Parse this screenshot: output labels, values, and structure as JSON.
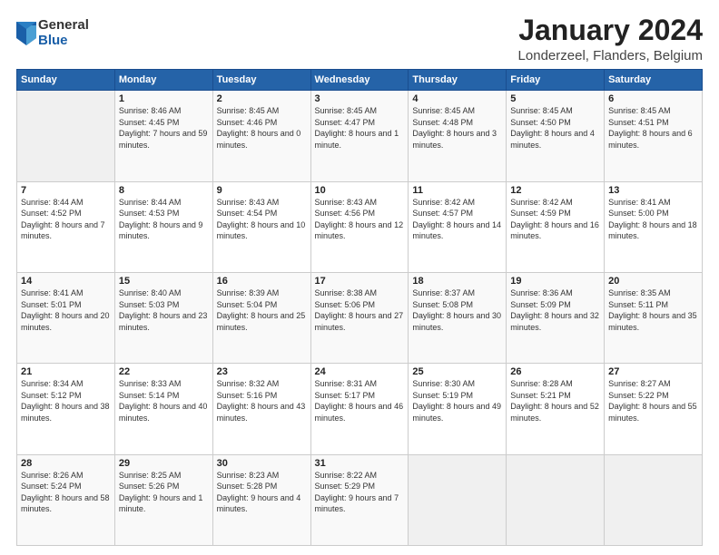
{
  "logo": {
    "general": "General",
    "blue": "Blue"
  },
  "title": "January 2024",
  "subtitle": "Londerzeel, Flanders, Belgium",
  "days_of_week": [
    "Sunday",
    "Monday",
    "Tuesday",
    "Wednesday",
    "Thursday",
    "Friday",
    "Saturday"
  ],
  "weeks": [
    [
      {
        "day": "",
        "sunrise": "",
        "sunset": "",
        "daylight": ""
      },
      {
        "day": "1",
        "sunrise": "Sunrise: 8:46 AM",
        "sunset": "Sunset: 4:45 PM",
        "daylight": "Daylight: 7 hours and 59 minutes."
      },
      {
        "day": "2",
        "sunrise": "Sunrise: 8:45 AM",
        "sunset": "Sunset: 4:46 PM",
        "daylight": "Daylight: 8 hours and 0 minutes."
      },
      {
        "day": "3",
        "sunrise": "Sunrise: 8:45 AM",
        "sunset": "Sunset: 4:47 PM",
        "daylight": "Daylight: 8 hours and 1 minute."
      },
      {
        "day": "4",
        "sunrise": "Sunrise: 8:45 AM",
        "sunset": "Sunset: 4:48 PM",
        "daylight": "Daylight: 8 hours and 3 minutes."
      },
      {
        "day": "5",
        "sunrise": "Sunrise: 8:45 AM",
        "sunset": "Sunset: 4:50 PM",
        "daylight": "Daylight: 8 hours and 4 minutes."
      },
      {
        "day": "6",
        "sunrise": "Sunrise: 8:45 AM",
        "sunset": "Sunset: 4:51 PM",
        "daylight": "Daylight: 8 hours and 6 minutes."
      }
    ],
    [
      {
        "day": "7",
        "sunrise": "Sunrise: 8:44 AM",
        "sunset": "Sunset: 4:52 PM",
        "daylight": "Daylight: 8 hours and 7 minutes."
      },
      {
        "day": "8",
        "sunrise": "Sunrise: 8:44 AM",
        "sunset": "Sunset: 4:53 PM",
        "daylight": "Daylight: 8 hours and 9 minutes."
      },
      {
        "day": "9",
        "sunrise": "Sunrise: 8:43 AM",
        "sunset": "Sunset: 4:54 PM",
        "daylight": "Daylight: 8 hours and 10 minutes."
      },
      {
        "day": "10",
        "sunrise": "Sunrise: 8:43 AM",
        "sunset": "Sunset: 4:56 PM",
        "daylight": "Daylight: 8 hours and 12 minutes."
      },
      {
        "day": "11",
        "sunrise": "Sunrise: 8:42 AM",
        "sunset": "Sunset: 4:57 PM",
        "daylight": "Daylight: 8 hours and 14 minutes."
      },
      {
        "day": "12",
        "sunrise": "Sunrise: 8:42 AM",
        "sunset": "Sunset: 4:59 PM",
        "daylight": "Daylight: 8 hours and 16 minutes."
      },
      {
        "day": "13",
        "sunrise": "Sunrise: 8:41 AM",
        "sunset": "Sunset: 5:00 PM",
        "daylight": "Daylight: 8 hours and 18 minutes."
      }
    ],
    [
      {
        "day": "14",
        "sunrise": "Sunrise: 8:41 AM",
        "sunset": "Sunset: 5:01 PM",
        "daylight": "Daylight: 8 hours and 20 minutes."
      },
      {
        "day": "15",
        "sunrise": "Sunrise: 8:40 AM",
        "sunset": "Sunset: 5:03 PM",
        "daylight": "Daylight: 8 hours and 23 minutes."
      },
      {
        "day": "16",
        "sunrise": "Sunrise: 8:39 AM",
        "sunset": "Sunset: 5:04 PM",
        "daylight": "Daylight: 8 hours and 25 minutes."
      },
      {
        "day": "17",
        "sunrise": "Sunrise: 8:38 AM",
        "sunset": "Sunset: 5:06 PM",
        "daylight": "Daylight: 8 hours and 27 minutes."
      },
      {
        "day": "18",
        "sunrise": "Sunrise: 8:37 AM",
        "sunset": "Sunset: 5:08 PM",
        "daylight": "Daylight: 8 hours and 30 minutes."
      },
      {
        "day": "19",
        "sunrise": "Sunrise: 8:36 AM",
        "sunset": "Sunset: 5:09 PM",
        "daylight": "Daylight: 8 hours and 32 minutes."
      },
      {
        "day": "20",
        "sunrise": "Sunrise: 8:35 AM",
        "sunset": "Sunset: 5:11 PM",
        "daylight": "Daylight: 8 hours and 35 minutes."
      }
    ],
    [
      {
        "day": "21",
        "sunrise": "Sunrise: 8:34 AM",
        "sunset": "Sunset: 5:12 PM",
        "daylight": "Daylight: 8 hours and 38 minutes."
      },
      {
        "day": "22",
        "sunrise": "Sunrise: 8:33 AM",
        "sunset": "Sunset: 5:14 PM",
        "daylight": "Daylight: 8 hours and 40 minutes."
      },
      {
        "day": "23",
        "sunrise": "Sunrise: 8:32 AM",
        "sunset": "Sunset: 5:16 PM",
        "daylight": "Daylight: 8 hours and 43 minutes."
      },
      {
        "day": "24",
        "sunrise": "Sunrise: 8:31 AM",
        "sunset": "Sunset: 5:17 PM",
        "daylight": "Daylight: 8 hours and 46 minutes."
      },
      {
        "day": "25",
        "sunrise": "Sunrise: 8:30 AM",
        "sunset": "Sunset: 5:19 PM",
        "daylight": "Daylight: 8 hours and 49 minutes."
      },
      {
        "day": "26",
        "sunrise": "Sunrise: 8:28 AM",
        "sunset": "Sunset: 5:21 PM",
        "daylight": "Daylight: 8 hours and 52 minutes."
      },
      {
        "day": "27",
        "sunrise": "Sunrise: 8:27 AM",
        "sunset": "Sunset: 5:22 PM",
        "daylight": "Daylight: 8 hours and 55 minutes."
      }
    ],
    [
      {
        "day": "28",
        "sunrise": "Sunrise: 8:26 AM",
        "sunset": "Sunset: 5:24 PM",
        "daylight": "Daylight: 8 hours and 58 minutes."
      },
      {
        "day": "29",
        "sunrise": "Sunrise: 8:25 AM",
        "sunset": "Sunset: 5:26 PM",
        "daylight": "Daylight: 9 hours and 1 minute."
      },
      {
        "day": "30",
        "sunrise": "Sunrise: 8:23 AM",
        "sunset": "Sunset: 5:28 PM",
        "daylight": "Daylight: 9 hours and 4 minutes."
      },
      {
        "day": "31",
        "sunrise": "Sunrise: 8:22 AM",
        "sunset": "Sunset: 5:29 PM",
        "daylight": "Daylight: 9 hours and 7 minutes."
      },
      {
        "day": "",
        "sunrise": "",
        "sunset": "",
        "daylight": ""
      },
      {
        "day": "",
        "sunrise": "",
        "sunset": "",
        "daylight": ""
      },
      {
        "day": "",
        "sunrise": "",
        "sunset": "",
        "daylight": ""
      }
    ]
  ]
}
